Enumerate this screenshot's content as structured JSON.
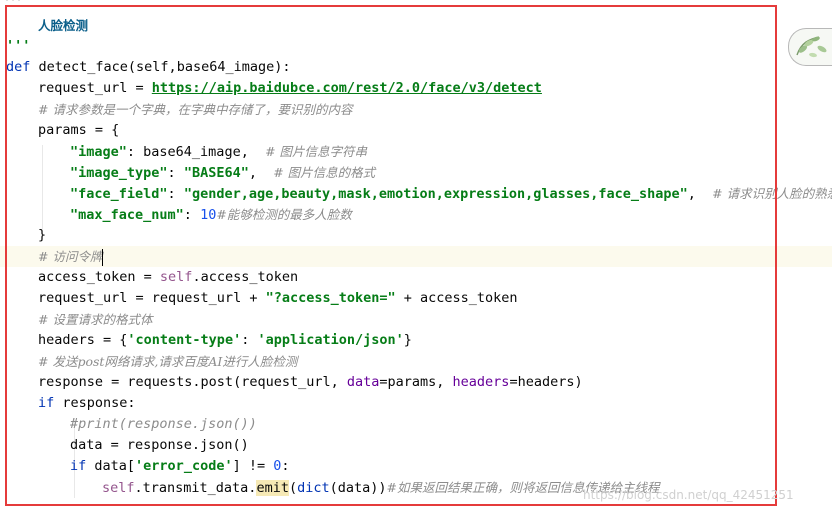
{
  "editor": {
    "doc_title": "人脸检测",
    "doc_quote": "'''",
    "func_name": "detect_face",
    "func_params": "(self,base64_image):",
    "url": "https://aip.baidubce.com/rest/2.0/face/v3/detect",
    "comment_params": "# 请求参数是一个字典，在字典中存储了，要识别的内容",
    "key_image": "\"image\"",
    "val_image": ": base64_image,  ",
    "cmt_image": "# 图片信息字符串",
    "key_image_type": "\"image_type\"",
    "val_image_type": "\"BASE64\"",
    "cmt_image_type": "# 图片信息的格式",
    "key_face_field": "\"face_field\"",
    "val_face_field": "\"gender,age,beauty,mask,emotion,expression,glasses,face_shape\"",
    "cmt_face_field": "# 请求识别人脸的熟悉",
    "key_max_face": "\"max_face_num\"",
    "val_max_face": "10",
    "cmt_max_face": "#能够检测的最多人脸数",
    "comment_token": "# 访问令牌",
    "access_token_var": "access_token",
    "token_query": "\"?access_token=\"",
    "comment_header": "# 设置请求的格式体",
    "header_key": "'content-type'",
    "header_val": "'application/json'",
    "comment_post": "# 发送post网络请求,请求百度AI进行人脸检测",
    "print_comment": "#print(response.json())",
    "error_code_key": "'error_code'",
    "zero": "0",
    "emit_comment": "#如果返回结果正确，则将返回信息传递给主线程"
  },
  "watermark": "https://blog.csdn.net/qq_42451251"
}
